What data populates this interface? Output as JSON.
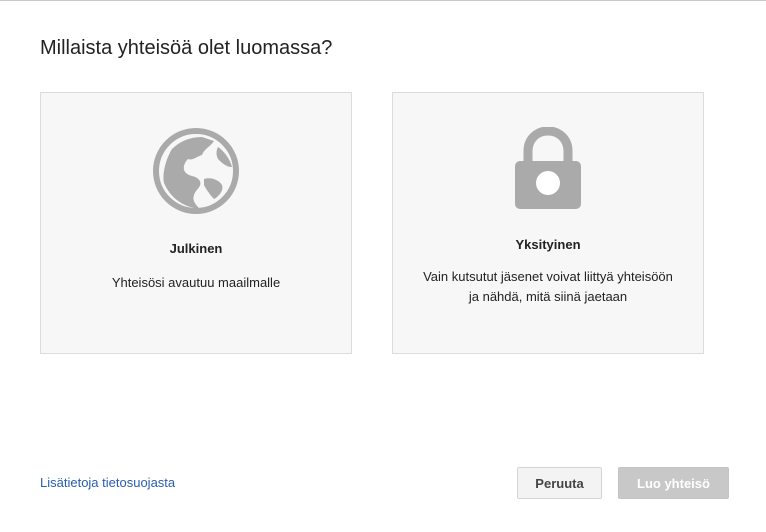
{
  "dialog": {
    "title": "Millaista yhteisöä olet luomassa?"
  },
  "options": [
    {
      "label": "Julkinen",
      "description": "Yhteisösi avautuu maailmalle",
      "icon": "globe-icon"
    },
    {
      "label": "Yksityinen",
      "description": "Vain kutsutut jäsenet voivat liittyä yhteisöön ja nähdä, mitä siinä jaetaan",
      "icon": "lock-icon"
    }
  ],
  "footer": {
    "privacy_link": "Lisätietoja tietosuojasta",
    "cancel_label": "Peruuta",
    "create_label": "Luo yhteisö"
  },
  "colors": {
    "icon_gray": "#aaaaaa",
    "link_blue": "#2a5db0",
    "card_bg": "#f7f7f7",
    "disabled_button": "#c8c8c8"
  }
}
